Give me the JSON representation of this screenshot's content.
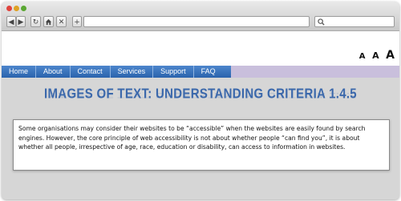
{
  "browser": {
    "buttons": {
      "back": "◀",
      "forward": "▶",
      "reload": "↻",
      "stop": "✕",
      "new_tab": "+"
    },
    "address_value": "",
    "search_value": ""
  },
  "page": {
    "text_size": {
      "small": "A",
      "medium": "A",
      "large": "A"
    },
    "nav": [
      "Home",
      "About",
      "Contact",
      "Services",
      "Support",
      "FAQ"
    ],
    "title": "IMAGES OF TEXT: UNDERSTANDING CRITERIA 1.4.5",
    "body": "Some organisations may consider their websites to be “accessible” when the websites are easily found by search engines. However, the core principle of web accessibility is not about whether people “can find you”, it is about whether all people, irrespective of age, race, education or disability, can access to information in websites."
  },
  "colors": {
    "nav_blue": "#2a63ad",
    "title_blue": "#3b68ab",
    "nav_strip": "#c9bfdc"
  },
  "icons": [
    "back-icon",
    "forward-icon",
    "reload-icon",
    "home-icon",
    "stop-icon",
    "add-tab-icon",
    "search-icon"
  ]
}
